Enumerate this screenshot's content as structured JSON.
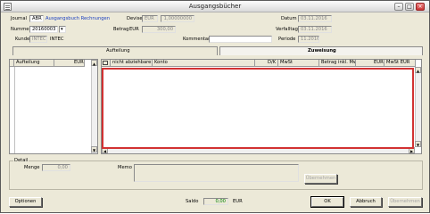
{
  "window": {
    "title": "Ausgangsbücher",
    "minimize": "–",
    "maximize": "□",
    "close": "×"
  },
  "form": {
    "journal_label": "Journal",
    "journal_code": "ABR",
    "journal_name": "Ausgangsbuch Rechnungen",
    "devise_label": "Devise",
    "devise_value": "EUR",
    "rate_value": "1,00000000",
    "datum_label": "Datum",
    "datum_value": "03.11.2016",
    "nummer_label": "Nummer",
    "nummer_value": "20160003",
    "betrag_label": "Betrag",
    "betrag_currency": "EUR",
    "betrag_value": "300,00",
    "verfalltag_label": "Verfalltag",
    "verfalltag_value": "03.11.2016",
    "kunde_label": "Kunde",
    "kunde_code": "INTEC",
    "kunde_name": "INTEC",
    "kommentar_label": "Kommentar",
    "kommentar_value": "",
    "periode_label": "Periode",
    "periode_value": "11.2016"
  },
  "tabs": {
    "aufteilung": "Aufteilung",
    "zuweisung": "Zuweisung"
  },
  "left_grid": {
    "columns": [
      "Aufteilung",
      "EUR"
    ]
  },
  "main_grid": {
    "columns": [
      "",
      "nicht abziehbare ...",
      "Konto",
      "D/K",
      "MwSt",
      "Betrag inkl. MwSt",
      "EUR",
      "MwSt EUR"
    ]
  },
  "detail": {
    "group_label": "Detail",
    "menge_label": "Menge",
    "menge_value": "0,00",
    "memo_label": "Memo",
    "memo_value": "",
    "uebernehmen_label": "Übernehmen"
  },
  "footer": {
    "optionen_label": "Optionen",
    "saldo_label": "Saldo",
    "saldo_value": "0,00",
    "saldo_currency": "EUR",
    "ok_label": "OK",
    "abbruch_label": "Abbruch",
    "uebernehmen_label": "Übernehmen"
  },
  "colors": {
    "highlight_border": "#d23232",
    "link_blue": "#1a3fc0",
    "saldo_green": "#008000"
  }
}
